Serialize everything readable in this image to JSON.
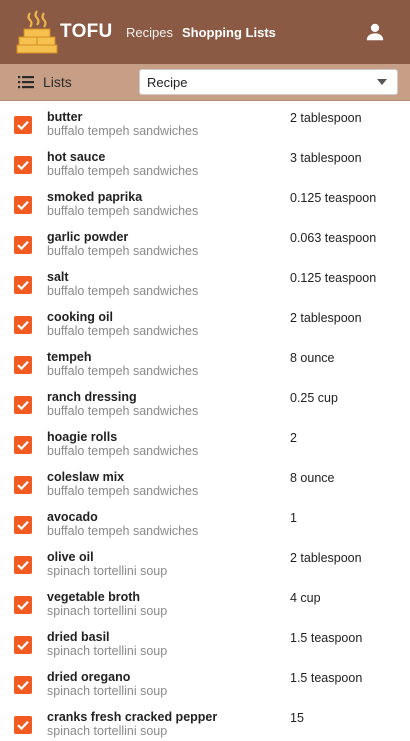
{
  "app": {
    "brand": "TOFU",
    "nav": [
      {
        "label": "Recipes"
      },
      {
        "label": "Shopping Lists"
      }
    ],
    "account_icon": "account-icon",
    "logo_icon": "tofu-logo"
  },
  "toolbar": {
    "lists_label": "Lists",
    "lists_icon": "list-icon",
    "select_value": "Recipe"
  },
  "colors": {
    "appbar": "#8a5a44",
    "toolbar": "#c79f87",
    "checkbox": "#f25a22"
  },
  "items": [
    {
      "name": "butter",
      "recipe": "buffalo tempeh sandwiches",
      "qty": "2 tablespoon",
      "checked": true
    },
    {
      "name": "hot sauce",
      "recipe": "buffalo tempeh sandwiches",
      "qty": "3 tablespoon",
      "checked": true
    },
    {
      "name": "smoked paprika",
      "recipe": "buffalo tempeh sandwiches",
      "qty": "0.125 teaspoon",
      "checked": true
    },
    {
      "name": "garlic powder",
      "recipe": "buffalo tempeh sandwiches",
      "qty": "0.063 teaspoon",
      "checked": true
    },
    {
      "name": "salt",
      "recipe": "buffalo tempeh sandwiches",
      "qty": "0.125 teaspoon",
      "checked": true
    },
    {
      "name": "cooking oil",
      "recipe": "buffalo tempeh sandwiches",
      "qty": "2 tablespoon",
      "checked": true
    },
    {
      "name": "tempeh",
      "recipe": "buffalo tempeh sandwiches",
      "qty": "8 ounce",
      "checked": true
    },
    {
      "name": "ranch dressing",
      "recipe": "buffalo tempeh sandwiches",
      "qty": "0.25 cup",
      "checked": true
    },
    {
      "name": "hoagie rolls",
      "recipe": "buffalo tempeh sandwiches",
      "qty": "2",
      "checked": true
    },
    {
      "name": "coleslaw mix",
      "recipe": "buffalo tempeh sandwiches",
      "qty": "8 ounce",
      "checked": true
    },
    {
      "name": "avocado",
      "recipe": "buffalo tempeh sandwiches",
      "qty": "1",
      "checked": true
    },
    {
      "name": "olive oil",
      "recipe": "spinach tortellini soup",
      "qty": "2 tablespoon",
      "checked": true
    },
    {
      "name": "vegetable broth",
      "recipe": "spinach tortellini soup",
      "qty": "4 cup",
      "checked": true
    },
    {
      "name": "dried basil",
      "recipe": "spinach tortellini soup",
      "qty": "1.5 teaspoon",
      "checked": true
    },
    {
      "name": "dried oregano",
      "recipe": "spinach tortellini soup",
      "qty": "1.5 teaspoon",
      "checked": true
    },
    {
      "name": "cranks fresh cracked pepper",
      "recipe": "spinach tortellini soup",
      "qty": "15",
      "checked": true
    }
  ]
}
